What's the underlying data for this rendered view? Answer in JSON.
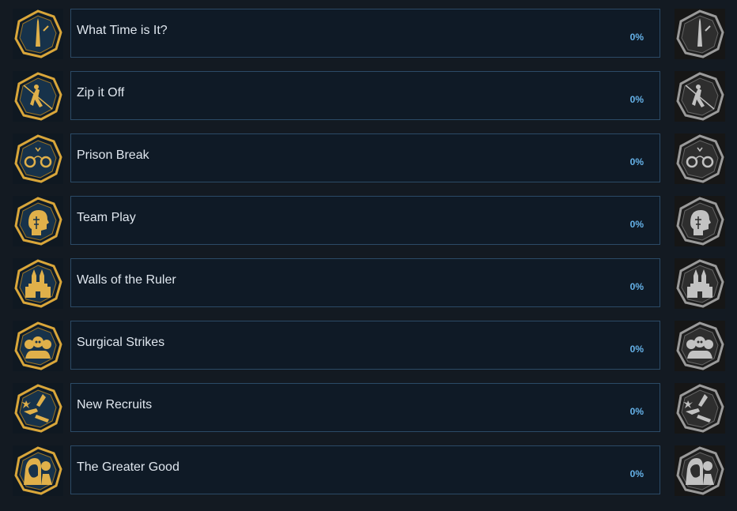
{
  "achievements": [
    {
      "name": "What Time is It?",
      "percent": "0%",
      "icon": "obelisk-icon"
    },
    {
      "name": "Zip it Off",
      "percent": "0%",
      "icon": "zipline-figure-icon"
    },
    {
      "name": "Prison Break",
      "percent": "0%",
      "icon": "handcuffs-icon"
    },
    {
      "name": "Team Play",
      "percent": "0%",
      "icon": "head-silhouette-icon"
    },
    {
      "name": "Walls of the Ruler",
      "percent": "0%",
      "icon": "castle-icon"
    },
    {
      "name": "Surgical Strikes",
      "percent": "0%",
      "icon": "skulls-group-icon"
    },
    {
      "name": "New Recruits",
      "percent": "0%",
      "icon": "hands-reaching-icon"
    },
    {
      "name": "The Greater Good",
      "percent": "0%",
      "icon": "hooded-figures-icon"
    }
  ],
  "colors": {
    "gold": "#d9a63a",
    "gray": "#b8b8b8",
    "percent": "#66b3ea"
  }
}
